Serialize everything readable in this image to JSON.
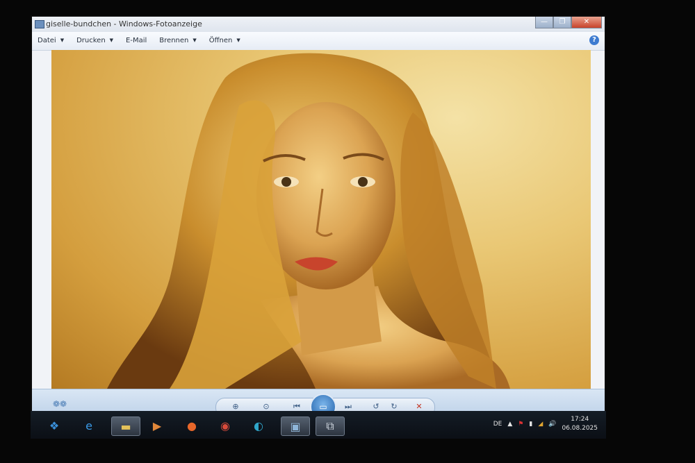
{
  "window": {
    "title": "giselle-bundchen - Windows-Fotoanzeige",
    "controls": {
      "minimize": "—",
      "maximize": "❐",
      "close": "✕"
    }
  },
  "menu": {
    "items": [
      {
        "label": "Datei",
        "has_arrow": true
      },
      {
        "label": "Drucken",
        "has_arrow": true
      },
      {
        "label": "E-Mail",
        "has_arrow": false
      },
      {
        "label": "Brennen",
        "has_arrow": true
      },
      {
        "label": "Öffnen",
        "has_arrow": true
      }
    ],
    "arrow_glyph": "▼",
    "help_label": "?"
  },
  "controls": {
    "zoom": "⊕",
    "fit": "⊙",
    "previous": "⏮",
    "slideshow": "▭",
    "next": "⏭",
    "rotate_left": "↺",
    "rotate_right": "↻",
    "delete": "✕"
  },
  "taskbar": {
    "icons": [
      {
        "name": "start-icon",
        "glyph": "❖",
        "color": "#3a8fd9"
      },
      {
        "name": "internet-explorer-icon",
        "glyph": "e",
        "color": "#3a9be8"
      },
      {
        "name": "file-explorer-icon",
        "glyph": "▬",
        "color": "#e3c15a"
      },
      {
        "name": "media-player-icon",
        "glyph": "▶",
        "color": "#e0873a"
      },
      {
        "name": "firefox-icon",
        "glyph": "●",
        "color": "#e8672a"
      },
      {
        "name": "chrome-icon",
        "glyph": "◉",
        "color": "#d94b3b"
      },
      {
        "name": "edge-icon",
        "glyph": "◐",
        "color": "#2fa6c9"
      },
      {
        "name": "photo-viewer-icon",
        "glyph": "▣",
        "color": "#8fb6d9"
      },
      {
        "name": "network-app-icon",
        "glyph": "⧉",
        "color": "#cfd6df"
      }
    ],
    "language": "DE",
    "time": "17:24",
    "date": "06.08.2025"
  },
  "colors": {
    "background_gold": "#e9c774",
    "hair": "#c48a2a",
    "skin": "#e0a957",
    "lips": "#c8442c"
  }
}
